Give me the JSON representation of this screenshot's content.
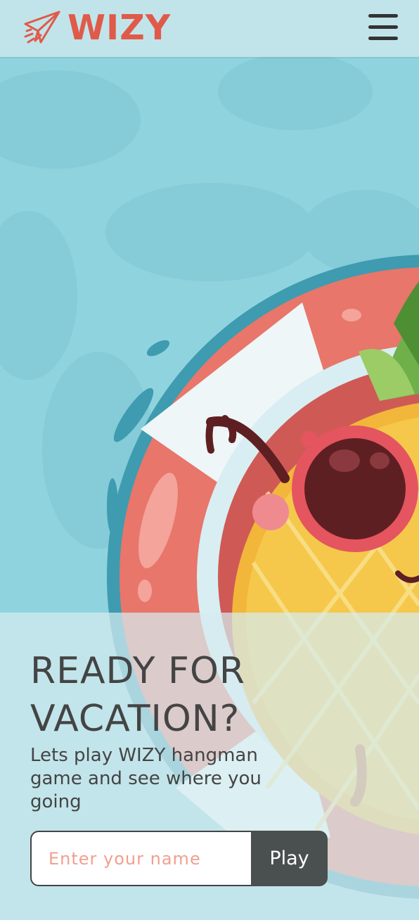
{
  "brand": {
    "name": "WIZY",
    "color": "#e05a4a"
  },
  "header": {
    "menu_icon": "hamburger-menu-icon"
  },
  "hero": {
    "title": "READY FOR VACATION?",
    "subtitle": "Lets play WIZY hangman game and see where you going",
    "illustration": "pineapple-in-swim-ring"
  },
  "form": {
    "name_placeholder": "Enter your name",
    "name_value": "",
    "play_label": "Play"
  },
  "colors": {
    "water": "#8fd3df",
    "ring_red": "#e8766a",
    "ring_white": "#eef6f7",
    "dark_button": "#4a4f4f",
    "text": "#444444"
  }
}
